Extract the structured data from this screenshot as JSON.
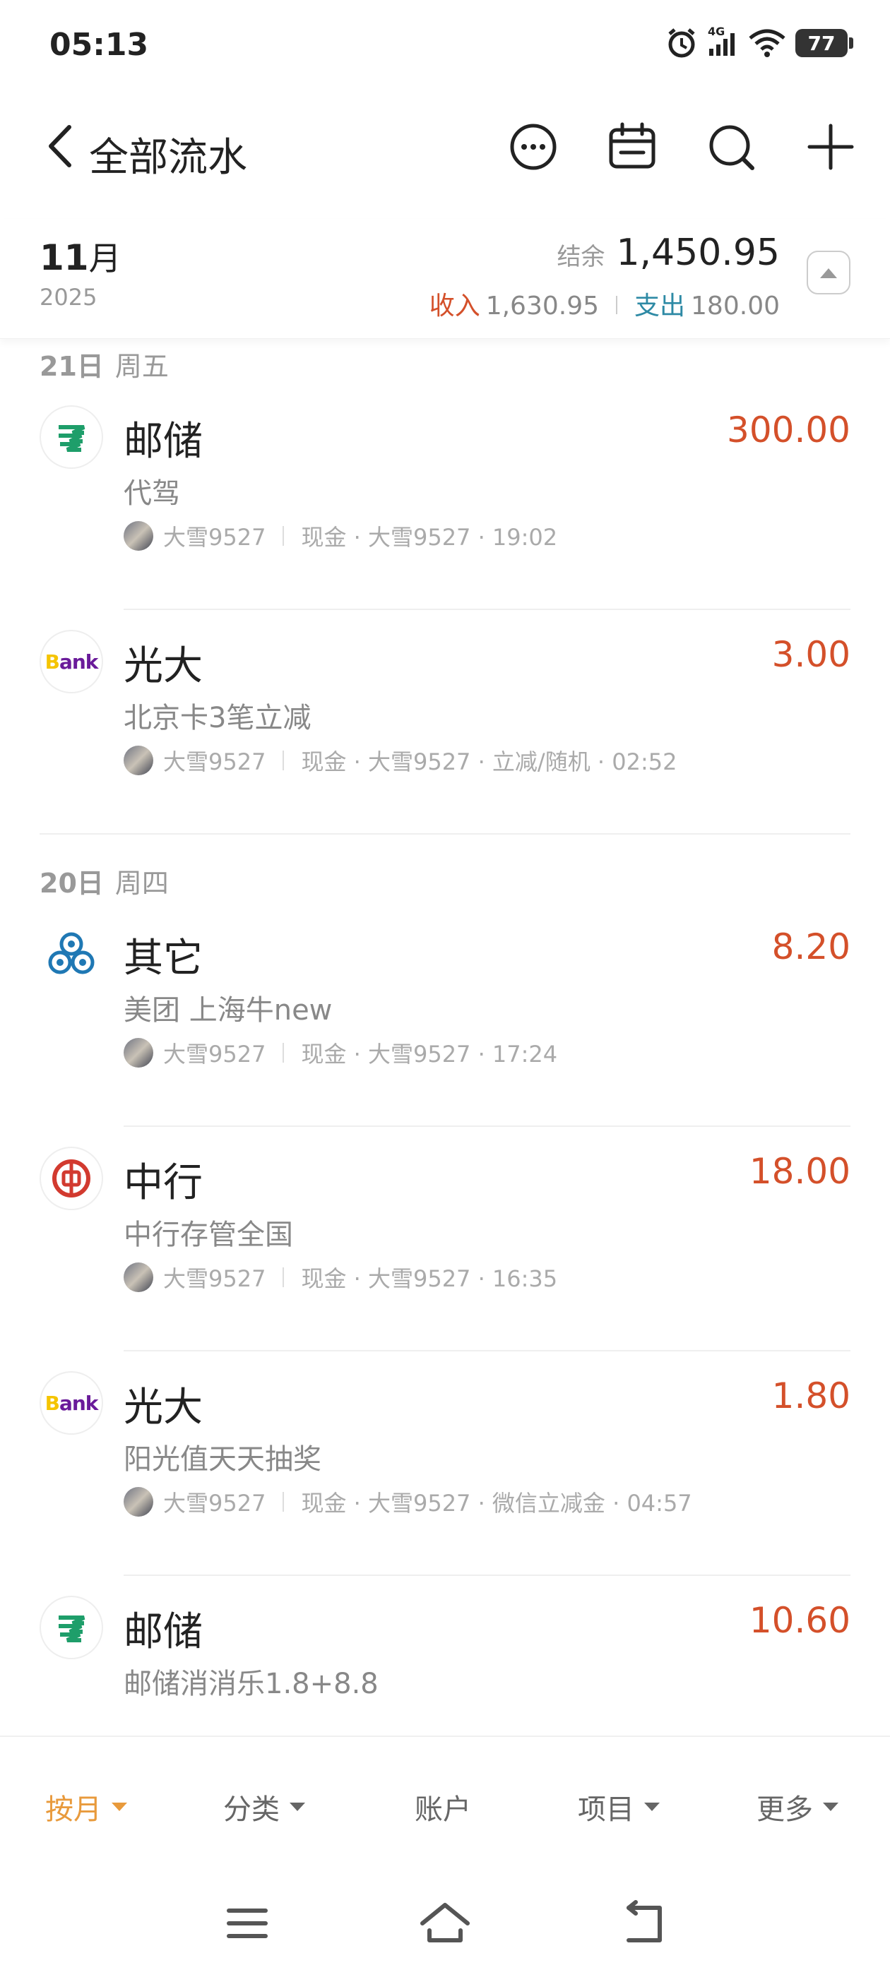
{
  "status_bar": {
    "time": "05:13",
    "network": "4G",
    "battery": "77"
  },
  "header": {
    "title": "全部流水"
  },
  "summary": {
    "month": "11",
    "month_unit": "月",
    "year": "2025",
    "balance_label": "结余",
    "balance_value": "1,450.95",
    "income_label": "收入",
    "income_value": "1,630.95",
    "expense_label": "支出",
    "expense_value": "180.00"
  },
  "days": [
    {
      "date": "21日",
      "weekday": "周五",
      "items": [
        {
          "icon": "postal-savings-icon",
          "title": "邮储",
          "amount": "300.00",
          "note": "代驾",
          "user": "大雪9527",
          "detail": "现金 · 大雪9527 · 19:02"
        },
        {
          "icon": "bank-logo-icon",
          "title": "光大",
          "amount": "3.00",
          "note": "北京卡3笔立减",
          "user": "大雪9527",
          "detail": "现金 · 大雪9527 · 立减/随机 · 02:52"
        }
      ]
    },
    {
      "date": "20日",
      "weekday": "周四",
      "items": [
        {
          "icon": "coins-icon",
          "title": "其它",
          "amount": "8.20",
          "note": "美团 上海牛new",
          "user": "大雪9527",
          "detail": "现金 · 大雪9527 · 17:24"
        },
        {
          "icon": "bank-of-china-icon",
          "title": "中行",
          "amount": "18.00",
          "note": "中行存管全国",
          "user": "大雪9527",
          "detail": "现金 · 大雪9527 · 16:35"
        },
        {
          "icon": "bank-logo-icon",
          "title": "光大",
          "amount": "1.80",
          "note": "阳光值天天抽奖",
          "user": "大雪9527",
          "detail": "现金 · 大雪9527 · 微信立减金 · 04:57"
        },
        {
          "icon": "postal-savings-icon",
          "title": "邮储",
          "amount": "10.60",
          "note": "邮储消消乐1.8+8.8",
          "user": "",
          "detail": ""
        }
      ]
    }
  ],
  "filters": {
    "by_month": "按月",
    "category": "分类",
    "account": "账户",
    "project": "项目",
    "more": "更多"
  },
  "colors": {
    "income": "#d4502a",
    "expense": "#2e8aa5",
    "accent": "#e89a3c",
    "postal_green": "#1e9e6a",
    "boc_red": "#d23a2f",
    "coins_blue": "#1f78b4"
  }
}
